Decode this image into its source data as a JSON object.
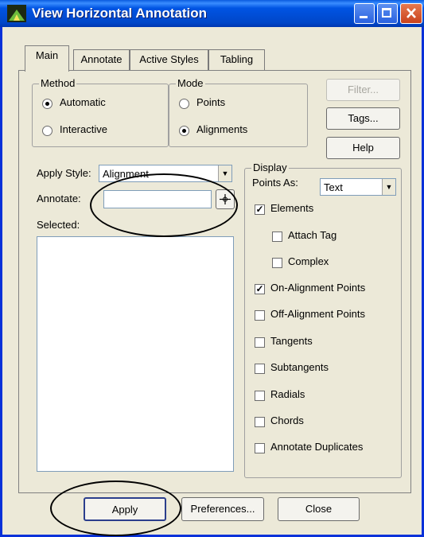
{
  "window": {
    "title": "View Horizontal Annotation"
  },
  "tabs": [
    "Main",
    "Annotate",
    "Active Styles",
    "Tabling"
  ],
  "method": {
    "label": "Method",
    "options": [
      "Automatic",
      "Interactive"
    ],
    "selected": "Automatic"
  },
  "mode": {
    "label": "Mode",
    "options": [
      "Points",
      "Alignments"
    ],
    "selected": "Alignments"
  },
  "side_buttons": {
    "filter": "Filter...",
    "tags": "Tags...",
    "help": "Help"
  },
  "apply_style": {
    "label": "Apply Style:",
    "value": "Alignment"
  },
  "annotate": {
    "label": "Annotate:",
    "value": ""
  },
  "selected": {
    "label": "Selected:"
  },
  "display": {
    "label": "Display",
    "points_as_label": "Points As:",
    "points_as_value": "Text",
    "checks": [
      {
        "label": "Elements",
        "checked": true
      },
      {
        "label": "Attach Tag",
        "checked": false
      },
      {
        "label": "Complex",
        "checked": false
      },
      {
        "label": "On-Alignment Points",
        "checked": true
      },
      {
        "label": "Off-Alignment Points",
        "checked": false
      },
      {
        "label": "Tangents",
        "checked": false
      },
      {
        "label": "Subtangents",
        "checked": false
      },
      {
        "label": "Radials",
        "checked": false
      },
      {
        "label": "Chords",
        "checked": false
      },
      {
        "label": "Annotate Duplicates",
        "checked": false
      }
    ]
  },
  "footer": {
    "apply": "Apply",
    "preferences": "Preferences...",
    "close": "Close"
  }
}
